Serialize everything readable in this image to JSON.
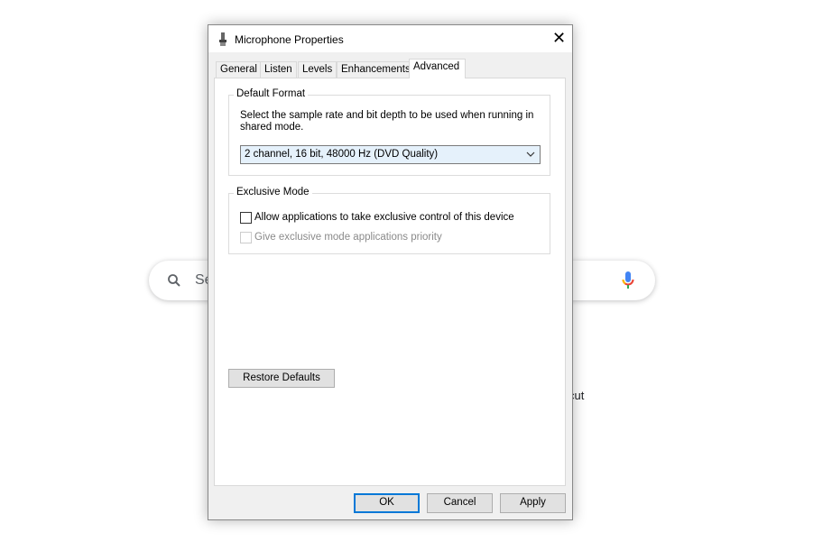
{
  "background": {
    "search_placeholder": "Se",
    "shortcut_fragment": "cut"
  },
  "dialog": {
    "title": "Microphone Properties",
    "tabs": [
      {
        "label": "General"
      },
      {
        "label": "Listen"
      },
      {
        "label": "Levels"
      },
      {
        "label": "Enhancements"
      },
      {
        "label": "Advanced",
        "active": true
      }
    ],
    "default_format": {
      "legend": "Default Format",
      "description": "Select the sample rate and bit depth to be used when running in shared mode.",
      "selected": "2 channel, 16 bit, 48000 Hz (DVD Quality)"
    },
    "exclusive_mode": {
      "legend": "Exclusive Mode",
      "allow_label": "Allow applications to take exclusive control of this device",
      "allow_checked": false,
      "priority_label": "Give exclusive mode applications priority",
      "priority_checked": false,
      "priority_enabled": false
    },
    "restore_label": "Restore Defaults",
    "ok_label": "OK",
    "cancel_label": "Cancel",
    "apply_label": "Apply"
  }
}
